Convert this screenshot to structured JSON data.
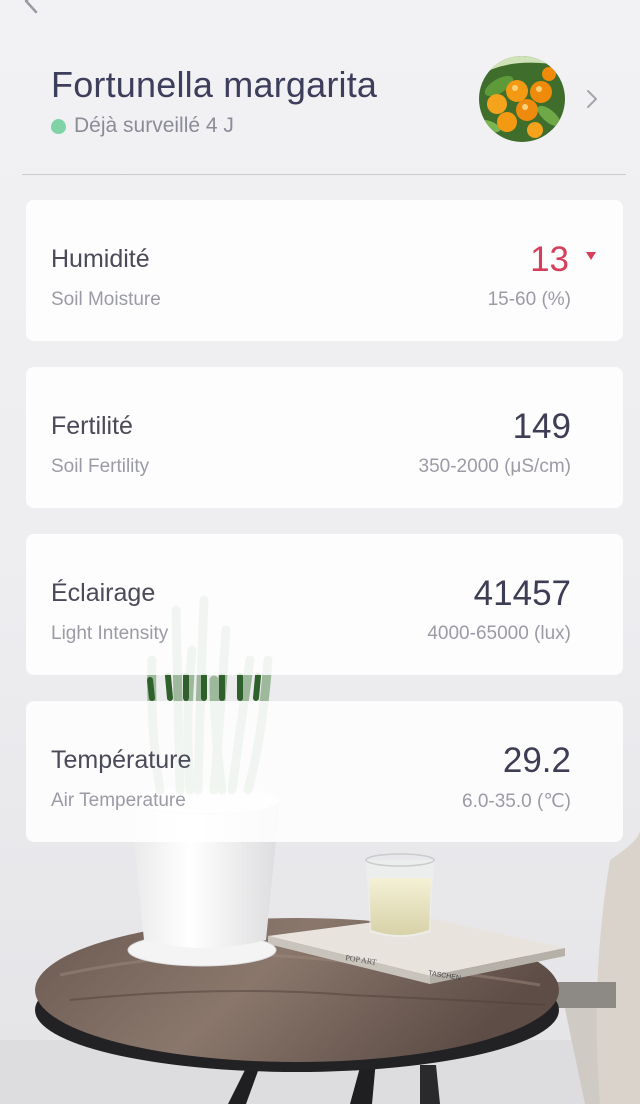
{
  "header": {
    "plant_name": "Fortunella margarita",
    "status_text": "Déjà surveillé 4 J",
    "status_color": "#7fd3a6"
  },
  "metrics": [
    {
      "label": "Humidité",
      "sublabel": "Soil Moisture",
      "value": "13",
      "range": "15-60 (%)",
      "alert": true
    },
    {
      "label": "Fertilité",
      "sublabel": "Soil Fertility",
      "value": "149",
      "range": "350-2000 (μS/cm)",
      "alert": false
    },
    {
      "label": "Éclairage",
      "sublabel": "Light Intensity",
      "value": "41457",
      "range": "4000-65000 (lux)",
      "alert": false
    },
    {
      "label": "Température",
      "sublabel": "Air Temperature",
      "value": "29.2",
      "range": "6.0-35.0 (℃)",
      "alert": false
    }
  ],
  "colors": {
    "alert": "#d73e5c",
    "title": "#3d3d5c",
    "muted": "#9b9ba6"
  },
  "icons": {
    "back": "back-arrow-icon",
    "more": "more-icon",
    "chevron": "chevron-right-icon"
  },
  "book": {
    "title": "POP ART",
    "publisher": "TASCHEN"
  }
}
